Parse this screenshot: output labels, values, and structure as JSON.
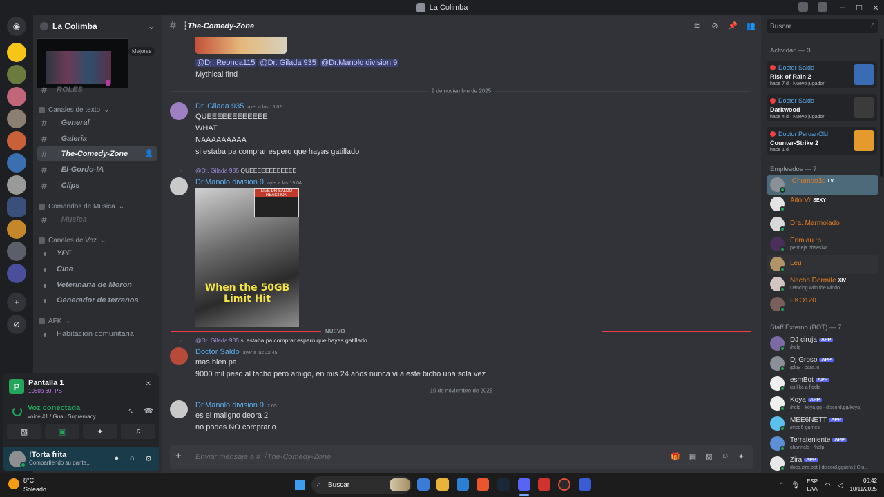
{
  "window": {
    "title": "La Colimba"
  },
  "guild": {
    "name": "La Colimba",
    "boost_label": "Mejoras"
  },
  "categories": [
    {
      "name": "Canales de texto"
    },
    {
      "name": "Comandos de Musica"
    },
    {
      "name": "Canales de Voz"
    },
    {
      "name": "AFK"
    }
  ],
  "channels": [
    {
      "label": "ROLES"
    },
    {
      "label": "┆General"
    },
    {
      "label": "┆Galeria"
    },
    {
      "label": "┆The-Comedy-Zone"
    },
    {
      "label": "┆El-Gordo-IA"
    },
    {
      "label": "┆Clips"
    },
    {
      "label": "┆Musica"
    },
    {
      "label": "YPF"
    },
    {
      "label": "Cine"
    },
    {
      "label": "Veterinaria de Moron"
    },
    {
      "label": "Generador de terrenos"
    },
    {
      "label": "Habitacion comunitaria"
    }
  ],
  "stream": {
    "title": "Pantalla 1",
    "quality": "1080p 60FPS"
  },
  "voice": {
    "status": "Voz conectada",
    "location": "voice #1 / Guau Supremacy"
  },
  "user": {
    "name": "!Torta frita",
    "status": "Compartiendo su panta..."
  },
  "header": {
    "channel": "┆The-Comedy-Zone"
  },
  "messages": {
    "m0_mentions": [
      "@Dr. Reonda115",
      "@Dr. Gilada 935",
      "@Dr.Manolo division 9"
    ],
    "m0_text": "Mythical find",
    "date1": "9 de noviembre de 2025",
    "m1_author": "Dr. Gilada 935",
    "m1_time": "ayer a las 16:02",
    "m1_lines": [
      "QUEEEEEEEEEEEE",
      "WHAT",
      "NAAAAAAAAA",
      "si estaba pa comprar espero que hayas gatillado"
    ],
    "m2_reply_to": "@Dr. Gilada 935",
    "m2_reply_text": "QUEEEEEEEEEEEE",
    "m2_author": "Dr.Manolo division 9",
    "m2_time": "ayer a las 19:04",
    "m2_meme_caption": "When the 50GB Limit Hit",
    "m2_meme_tag": "LIVE DR SALDO REACTION",
    "new_label": "NUEVO",
    "m3_reply_to": "@Dr. Gilada 935",
    "m3_reply_text": "si estaba pa comprar espero que hayas gatillado",
    "m3_author": "Doctor Saldo",
    "m3_time": "ayer a las 22:45",
    "m3_lines": [
      "mas bien pa",
      "9000 mil peso al tacho pero amigo, en mis 24 años nunca vi a este bicho una sola vez"
    ],
    "date2": "10 de noviembre de 2025",
    "m4_author": "Dr.Manolo division 9",
    "m4_time": "2:05",
    "m4_lines": [
      "es el maligno deora 2",
      "no podes NO comprarlo"
    ]
  },
  "composer": {
    "placeholder": "Enviar mensaje a # ┆The-Comedy-Zone"
  },
  "members": {
    "search_placeholder": "Buscar",
    "activity_header": "Actividad — 3",
    "activities": [
      {
        "user": "Doctor Saldo",
        "game": "Risk of Rain 2",
        "meta": "hace 7 d  ·  Nuevo jugador"
      },
      {
        "user": "Doctor Saldo",
        "game": "Darkwood",
        "meta": "hace 4 d  ·  Nuevo jugador"
      },
      {
        "user": "Doctor PeruanOld",
        "game": "Counter-Strike 2",
        "meta": "hace 1 d"
      }
    ],
    "empleados_header": "Empleados — 7",
    "empleados": [
      {
        "name": "!Chumbo3p",
        "tag": "LV",
        "status": ""
      },
      {
        "name": "AitorVr",
        "tag": "SEXY",
        "status": ""
      },
      {
        "name": "Dra. Marmolado",
        "tag": "",
        "status": ""
      },
      {
        "name": "Erimiau :p",
        "tag": "",
        "status": "pendeja obsesiva"
      },
      {
        "name": "Leu",
        "tag": "",
        "status": ""
      },
      {
        "name": "Nacho Dormite",
        "tag": "XIV",
        "status": "Dancing with the windo..."
      },
      {
        "name": "PKO120",
        "tag": "",
        "status": ""
      }
    ],
    "bots_header": "Staff Externo (BOT) — 7",
    "bots": [
      {
        "name": "DJ ciruja",
        "tag": "APP",
        "status": "/help"
      },
      {
        "name": "Dj Groso",
        "tag": "APP",
        "status": "/play · eara.io"
      },
      {
        "name": "esmBot",
        "tag": "APP",
        "status": "us like a fiddle"
      },
      {
        "name": "Koya",
        "tag": "APP",
        "status": "/help · koya.gg · discord.gg/koya"
      },
      {
        "name": "MEE6NETT",
        "tag": "APP",
        "status": "/mee6-games"
      },
      {
        "name": "Terrateniente",
        "tag": "APP",
        "status": "channels - /help"
      },
      {
        "name": "Zira",
        "tag": "APP",
        "status": "docs.zira.bot | discord.gg/zira | Clu..."
      }
    ]
  },
  "taskbar": {
    "temp": "8°C",
    "weather": "Soleado",
    "search_label": "Buscar",
    "lang_1": "ESP",
    "lang_2": "LAA",
    "time": "06:42",
    "date": "10/11/2025"
  }
}
